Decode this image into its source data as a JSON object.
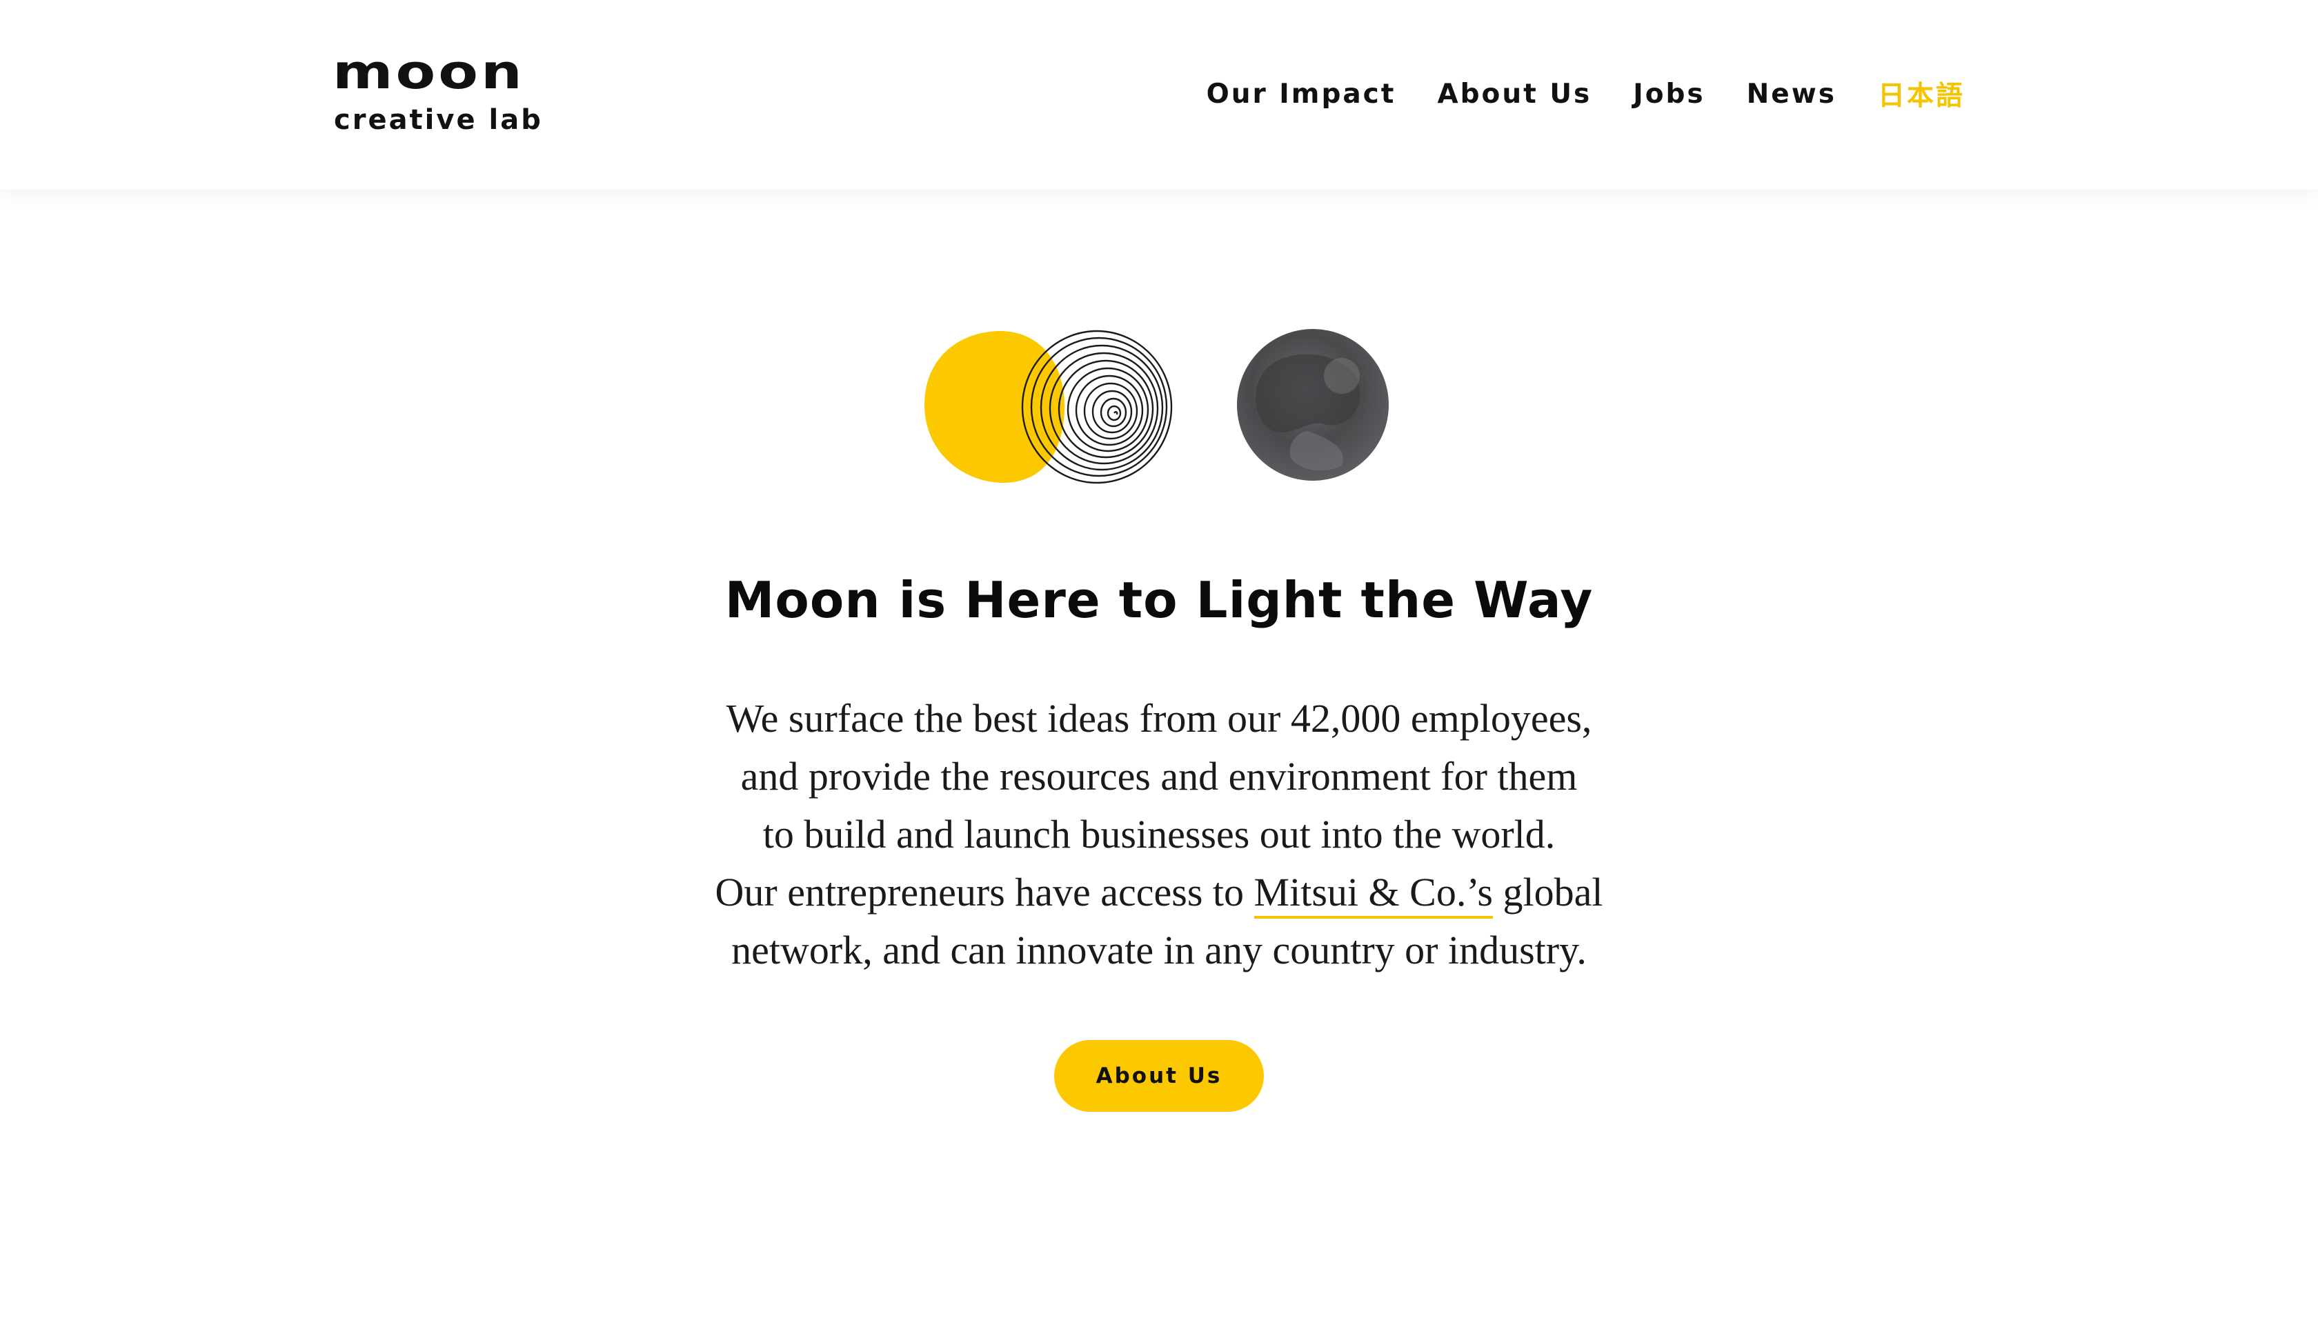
{
  "brand": {
    "word": "moon",
    "sub": "creative lab"
  },
  "nav": {
    "items": [
      {
        "label": "Our Impact"
      },
      {
        "label": "About Us"
      },
      {
        "label": "Jobs"
      },
      {
        "label": "News"
      }
    ],
    "lang": "日本語"
  },
  "hero": {
    "icons": [
      "yellow-sun-icon",
      "fingerprint-spiral-icon",
      "ink-moon-icon"
    ],
    "title": "Moon is Here to Light the Way",
    "body": {
      "line1": "We surface the best ideas from our 42,000 employees,",
      "line2": "and provide the resources and environment for them",
      "line3": "to build and launch businesses out into the world.",
      "line4_before": "Our entrepreneurs have access to ",
      "line4_link": "Mitsui & Co.’s",
      "line4_after": " global",
      "line5": "network, and can innovate in any country or industry."
    },
    "cta_label": "About Us"
  },
  "colors": {
    "accent": "#fcc900",
    "lang": "#f5c400",
    "text": "#111111",
    "moon": "#4a4a4d"
  }
}
